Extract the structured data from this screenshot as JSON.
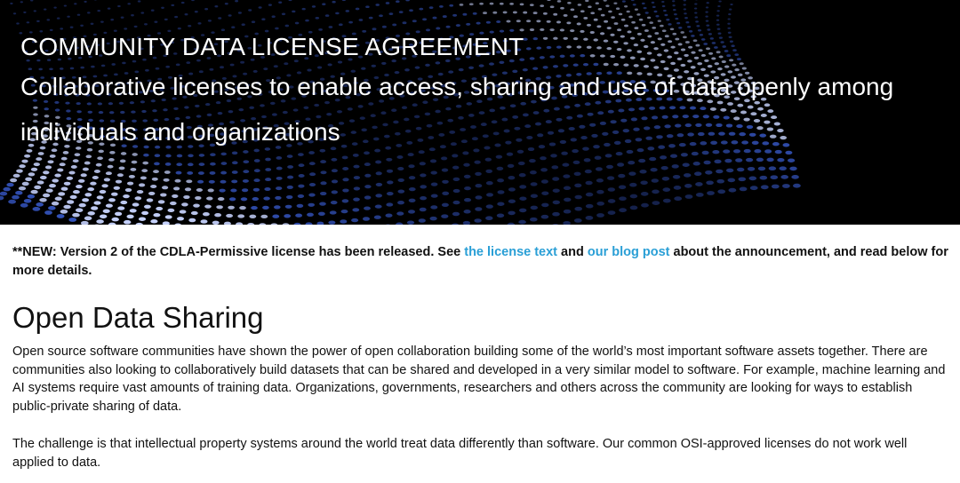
{
  "hero": {
    "title": "COMMUNITY DATA LICENSE AGREEMENT",
    "subtitle": "Collaborative licenses to enable access, sharing and use of data openly among individuals and organizations",
    "colors": {
      "background": "#000000",
      "dots": "#3b5fd6",
      "dots_light": "#c8d4ff"
    }
  },
  "notice": {
    "prefix": "**NEW: Version 2 of the CDLA-Permissive license has been released. See ",
    "link1": "the license text",
    "middle": " and ",
    "link2": "our blog post",
    "suffix": " about the announcement, and read below for more details."
  },
  "main": {
    "section_title": "Open Data Sharing",
    "paragraphs": [
      "Open source software communities have shown the power of open collaboration building some of the world’s most important software assets together. There are communities also looking to collaboratively build datasets that can be shared and developed in a very similar model to software. For example, machine learning and AI systems require vast amounts of training data. Organizations, governments, researchers and others across the community are looking for ways to establish public-private sharing of data.",
      "The challenge is that intellectual property systems around the world treat data differently than software. Our common OSI-approved licenses do not work well applied to data."
    ]
  },
  "colors": {
    "link": "#2a9fd6",
    "text": "#111111"
  }
}
